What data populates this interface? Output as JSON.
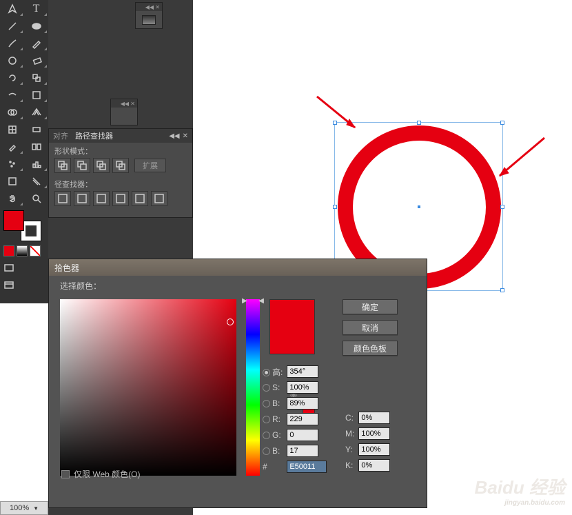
{
  "pathfinder": {
    "tab1": "对齐",
    "tab2": "路径查找器",
    "shape_mode": "形状模式：",
    "expand": "扩展",
    "pathfinders_label": "径查找器："
  },
  "picker": {
    "title": "拾色器",
    "label": "选择颜色：",
    "ok": "确定",
    "cancel": "取消",
    "swatches": "颜色色板",
    "H": {
      "label": "高:",
      "value": "354°"
    },
    "S": {
      "label": "S:",
      "value": "100%"
    },
    "Bv": {
      "label": "B:",
      "value": "89%"
    },
    "R": {
      "label": "R:",
      "value": "229"
    },
    "G": {
      "label": "G:",
      "value": "0"
    },
    "Bb": {
      "label": "B:",
      "value": "17"
    },
    "C": {
      "label": "C:",
      "value": "0%"
    },
    "M": {
      "label": "M:",
      "value": "100%"
    },
    "Y": {
      "label": "Y:",
      "value": "100%"
    },
    "K": {
      "label": "K:",
      "value": "0%"
    },
    "hex_prefix": "#",
    "hex": "E50011",
    "webonly": "仅限 Web 颜色(O)"
  },
  "zoom": "100%",
  "watermark": {
    "main": "Baidu 经验",
    "sub": "jingyan.baidu.com"
  },
  "colors": {
    "accent": "#e50011"
  }
}
